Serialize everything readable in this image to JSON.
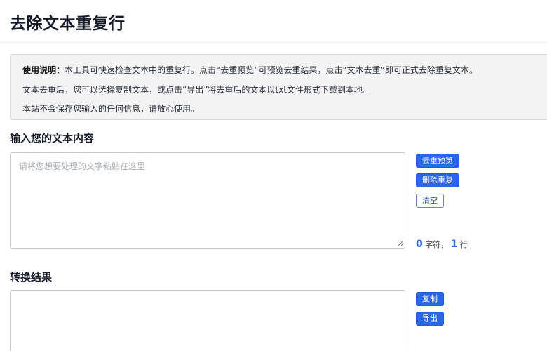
{
  "page": {
    "title": "去除文本重复行"
  },
  "notice": {
    "label": "使用说明：",
    "line1": "本工具可快速检查文本中的重复行。点击“去重预览”可预览去重结果，点击“文本去重”即可正式去除重复文本。",
    "line2": "文本去重后，您可以选择复制文本，或点击“导出”将去重后的文本以txt文件形式下载到本地。",
    "line3": "本站不会保存您输入的任何信息，请放心使用。"
  },
  "input_section": {
    "heading": "输入您的文本内容",
    "placeholder": "请将您想要处理的文字粘贴在这里",
    "value": ""
  },
  "actions": {
    "preview": "去重预览",
    "remove": "删除重复",
    "clear": "清空"
  },
  "counter": {
    "chars": "0",
    "chars_unit": "字符，",
    "lines": "1",
    "lines_unit": "行"
  },
  "result_section": {
    "heading": "转换结果",
    "value": ""
  },
  "result_actions": {
    "copy": "复制",
    "export": "导出"
  },
  "colors": {
    "primary": "#2b65e8",
    "notice_bg": "#f4f4f5"
  }
}
